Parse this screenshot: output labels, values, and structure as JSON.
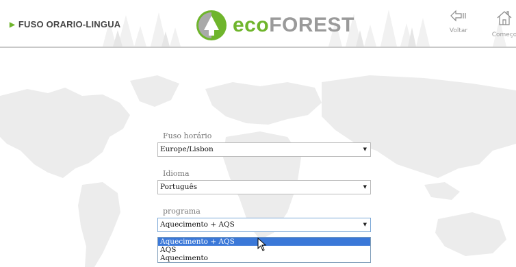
{
  "header": {
    "page_title": "FUSO ORARIO-LINGUA",
    "logo": {
      "eco": "eco",
      "forest": "FOREST"
    },
    "nav": {
      "back": {
        "label": "Voltar",
        "icon": "back-arrow-icon"
      },
      "home": {
        "label": "Começo",
        "icon": "home-icon"
      }
    }
  },
  "form": {
    "timezone": {
      "label": "Fuso horário",
      "value": "Europe/Lisbon"
    },
    "language": {
      "label": "Idioma",
      "value": "Português"
    },
    "program": {
      "label": "programa",
      "value": "Aquecimento + AQS",
      "options": [
        "Aquecimento + AQS",
        "AQS",
        "Aquecimento"
      ],
      "highlighted": "Aquecimento + AQS"
    }
  },
  "colors": {
    "brand_green": "#6fb52c",
    "brand_gray": "#9a9a9a",
    "selection_blue": "#3b78d8",
    "map_gray": "#ececec"
  }
}
